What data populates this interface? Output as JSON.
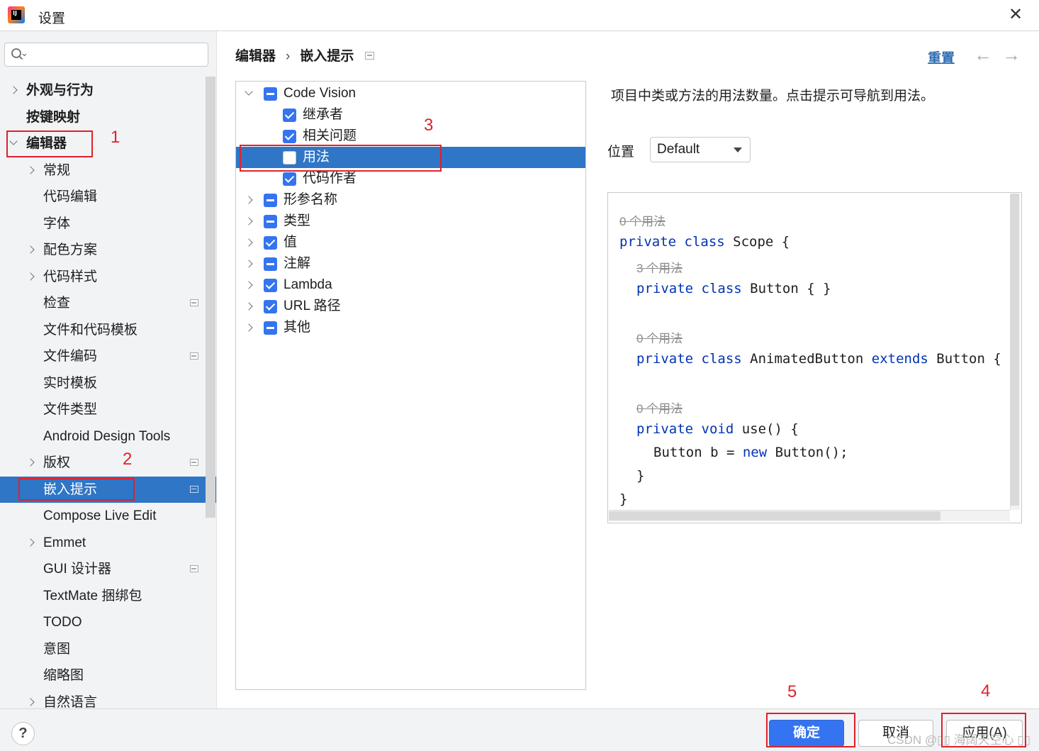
{
  "window": {
    "title": "设置",
    "close_glyph": "✕",
    "logo_text": "IJ"
  },
  "search": {
    "placeholder": "",
    "value": ""
  },
  "sidebar": {
    "items": [
      {
        "label": "外观与行为",
        "expander": "right",
        "bold": true
      },
      {
        "label": "按键映射",
        "expander": "none",
        "bold": true
      },
      {
        "label": "编辑器",
        "expander": "down",
        "bold": true
      },
      {
        "label": "常规",
        "expander": "right"
      },
      {
        "label": "代码编辑",
        "expander": "none"
      },
      {
        "label": "字体",
        "expander": "none"
      },
      {
        "label": "配色方案",
        "expander": "right"
      },
      {
        "label": "代码样式",
        "expander": "right"
      },
      {
        "label": "检查",
        "expander": "none",
        "badge": true
      },
      {
        "label": "文件和代码模板",
        "expander": "none"
      },
      {
        "label": "文件编码",
        "expander": "none",
        "badge": true
      },
      {
        "label": "实时模板",
        "expander": "none"
      },
      {
        "label": "文件类型",
        "expander": "none"
      },
      {
        "label": "Android Design Tools",
        "expander": "none"
      },
      {
        "label": "版权",
        "expander": "right",
        "badge": true
      },
      {
        "label": "嵌入提示",
        "expander": "none",
        "badge": true,
        "selected": true
      },
      {
        "label": "Compose Live Edit",
        "expander": "none"
      },
      {
        "label": "Emmet",
        "expander": "right"
      },
      {
        "label": "GUI 设计器",
        "expander": "none",
        "badge": true
      },
      {
        "label": "TextMate 捆绑包",
        "expander": "none"
      },
      {
        "label": "TODO",
        "expander": "none"
      },
      {
        "label": "意图",
        "expander": "none"
      },
      {
        "label": "缩略图",
        "expander": "none"
      },
      {
        "label": "自然语言",
        "expander": "right"
      }
    ]
  },
  "header": {
    "breadcrumb": [
      "编辑器",
      "嵌入提示"
    ],
    "separator": "›",
    "reset_label": "重置",
    "back_glyph": "←",
    "forward_glyph": "→"
  },
  "hints_tree": [
    {
      "label": "Code Vision",
      "expander": "down",
      "state": "partial",
      "level": 0
    },
    {
      "label": "继承者",
      "state": "checked",
      "level": 1
    },
    {
      "label": "相关问题",
      "state": "checked",
      "level": 1
    },
    {
      "label": "用法",
      "state": "unchecked",
      "level": 1,
      "selected": true
    },
    {
      "label": "代码作者",
      "state": "checked",
      "level": 1
    },
    {
      "label": "形参名称",
      "expander": "right",
      "state": "partial",
      "level": 0
    },
    {
      "label": "类型",
      "expander": "right",
      "state": "partial",
      "level": 0
    },
    {
      "label": "值",
      "expander": "right",
      "state": "checked",
      "level": 0
    },
    {
      "label": "注解",
      "expander": "right",
      "state": "partial",
      "level": 0
    },
    {
      "label": "Lambda",
      "expander": "right",
      "state": "checked",
      "level": 0
    },
    {
      "label": "URL 路径",
      "expander": "right",
      "state": "checked",
      "level": 0
    },
    {
      "label": "其他",
      "expander": "right",
      "state": "partial",
      "level": 0
    }
  ],
  "details": {
    "description": "项目中类或方法的用法数量。点击提示可导航到用法。",
    "position_label": "位置",
    "position_value": "Default"
  },
  "code_preview": [
    {
      "kind": "hint",
      "indent": 0,
      "text": "0 个用法"
    },
    {
      "kind": "code",
      "indent": 0,
      "parts": [
        [
          "kw",
          "private class "
        ],
        [
          "",
          "Scope {"
        ]
      ]
    },
    {
      "kind": "hint",
      "indent": 1,
      "text": "3 个用法"
    },
    {
      "kind": "code",
      "indent": 1,
      "parts": [
        [
          "kw",
          "private class "
        ],
        [
          "",
          "Button { }"
        ]
      ]
    },
    {
      "kind": "blank"
    },
    {
      "kind": "hint",
      "indent": 1,
      "text": "0 个用法"
    },
    {
      "kind": "code",
      "indent": 1,
      "parts": [
        [
          "kw",
          "private class "
        ],
        [
          "",
          "AnimatedButton "
        ],
        [
          "kw",
          "extends "
        ],
        [
          "",
          "Button {"
        ]
      ]
    },
    {
      "kind": "blank"
    },
    {
      "kind": "hint",
      "indent": 1,
      "text": "0 个用法"
    },
    {
      "kind": "code",
      "indent": 1,
      "parts": [
        [
          "kw",
          "private void "
        ],
        [
          "",
          "use() {"
        ]
      ]
    },
    {
      "kind": "code",
      "indent": 2,
      "parts": [
        [
          "",
          "Button b = "
        ],
        [
          "kw",
          "new "
        ],
        [
          "",
          "Button();"
        ]
      ]
    },
    {
      "kind": "code",
      "indent": 1,
      "parts": [
        [
          "",
          "}"
        ]
      ]
    },
    {
      "kind": "code",
      "indent": 0,
      "parts": [
        [
          "",
          "}"
        ]
      ]
    }
  ],
  "footer": {
    "help_label": "?",
    "ok_label": "确定",
    "cancel_label": "取消",
    "apply_label": "应用(A)",
    "watermark": "CSDN @▯▯ 海阔天空心 ▯▯"
  },
  "annotations": [
    "1",
    "2",
    "3",
    "4",
    "5"
  ],
  "colors": {
    "accent": "#3574f0",
    "selection": "#2f76c6",
    "keyword": "#0033b3",
    "annotation_red": "#e0212b",
    "link": "#2e6db3"
  }
}
